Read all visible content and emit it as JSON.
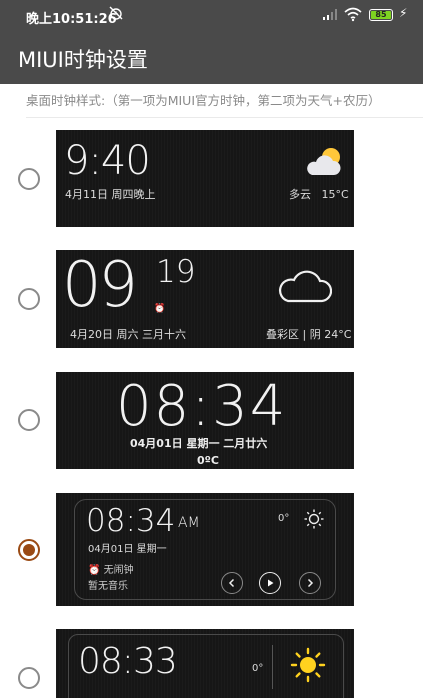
{
  "status_bar": {
    "time": "晚上10:51:26",
    "battery": "85",
    "icons": [
      "alarm-off-icon",
      "signal-icon",
      "wifi-icon",
      "battery-icon",
      "charging-icon"
    ]
  },
  "app_bar": {
    "title": "MIUI时钟设置"
  },
  "section": {
    "subtitle": "桌面时钟样式:（第一项为MIUI官方时钟，第二项为天气+农历）"
  },
  "styles": [
    {
      "selected": false,
      "time": "9:40",
      "date": "4月11日 周四晚上",
      "weather": "多云",
      "temp": "15°C",
      "weather_icon": "partly-cloudy-icon"
    },
    {
      "selected": false,
      "hour": "09",
      "minute": "19",
      "date": "4月20日  周六  三月十六",
      "location_weather": "叠彩区 | 阴 24°C",
      "weather_icon": "cloud-icon"
    },
    {
      "selected": false,
      "time": "08:34",
      "date": "04月01日  星期一  二月廿六",
      "temp": "0ºC"
    },
    {
      "selected": true,
      "time": "08:34",
      "ampm": "AM",
      "temp": "0°",
      "date": "04月01日  星期一",
      "no_alarm": "无闹钟",
      "no_music": "暂无音乐",
      "weather_icon": "sun-outline-icon"
    },
    {
      "selected": false,
      "time": "08:33",
      "temp": "0°",
      "weather_icon": "sun-icon"
    }
  ],
  "colors": {
    "bar": "#4a4a4a",
    "card": "#161616",
    "radio_checked": "#9a4a14",
    "sun": "#ffd21f"
  }
}
